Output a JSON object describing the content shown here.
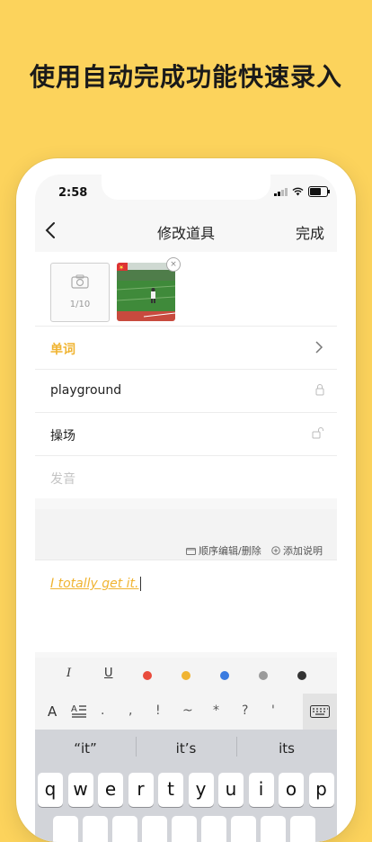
{
  "headline": "使用自动完成功能快速录入",
  "status": {
    "time": "2:58"
  },
  "nav": {
    "title": "修改道具",
    "done": "完成"
  },
  "photos": {
    "count": "1/10"
  },
  "fields": {
    "category": "单词",
    "word": "playground",
    "meaning": "操场",
    "pronunciation_placeholder": "发音"
  },
  "tools": {
    "reorder": "顺序编辑/删除",
    "add_note": "添加说明"
  },
  "note": {
    "text": "I totally get it."
  },
  "format": {
    "italic": "I",
    "underline": "U",
    "colors": [
      "#E94B3C",
      "#F0B432",
      "#3A7BE0",
      "#9a9a9a",
      "#333333"
    ]
  },
  "symbols": {
    "font_size": "A",
    "items": [
      ".",
      ",",
      "!",
      "~",
      "*",
      "?",
      "'"
    ]
  },
  "suggestions": [
    "“it”",
    "it’s",
    "its"
  ],
  "keys_row1": [
    "q",
    "w",
    "e",
    "r",
    "t",
    "y",
    "u",
    "i",
    "o",
    "p"
  ]
}
